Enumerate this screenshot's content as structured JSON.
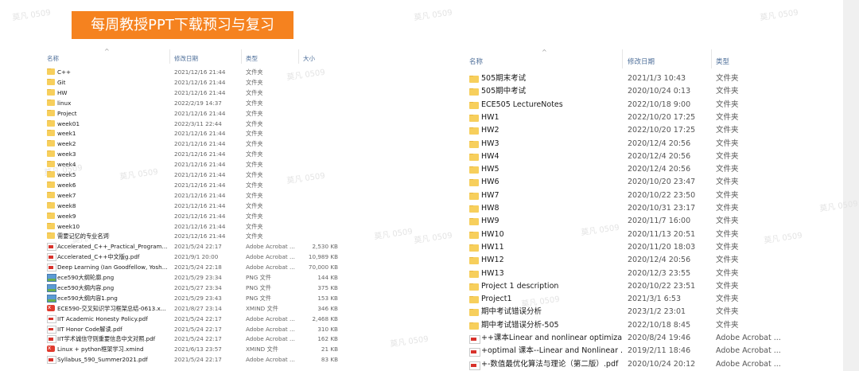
{
  "banner": {
    "title": "每周教授PPT下载预习与复习"
  },
  "watermark": "莫凡 0509",
  "left_panel": {
    "headers": {
      "name": "名称",
      "date": "修改日期",
      "type": "类型",
      "size": "大小"
    },
    "items": [
      {
        "icon": "folder-icon",
        "name": "C++",
        "date": "2021/12/16 21:44",
        "type": "文件夹",
        "size": ""
      },
      {
        "icon": "folder-icon",
        "name": "Git",
        "date": "2021/12/16 21:44",
        "type": "文件夹",
        "size": ""
      },
      {
        "icon": "folder-icon",
        "name": "HW",
        "date": "2021/12/16 21:44",
        "type": "文件夹",
        "size": ""
      },
      {
        "icon": "folder-icon",
        "name": "linux",
        "date": "2022/2/19 14:37",
        "type": "文件夹",
        "size": ""
      },
      {
        "icon": "folder-icon",
        "name": "Project",
        "date": "2021/12/16 21:44",
        "type": "文件夹",
        "size": ""
      },
      {
        "icon": "folder-icon",
        "name": "week01",
        "date": "2022/3/11 22:44",
        "type": "文件夹",
        "size": ""
      },
      {
        "icon": "folder-icon",
        "name": "week1",
        "date": "2021/12/16 21:44",
        "type": "文件夹",
        "size": ""
      },
      {
        "icon": "folder-icon",
        "name": "week2",
        "date": "2021/12/16 21:44",
        "type": "文件夹",
        "size": ""
      },
      {
        "icon": "folder-icon",
        "name": "week3",
        "date": "2021/12/16 21:44",
        "type": "文件夹",
        "size": ""
      },
      {
        "icon": "folder-icon",
        "name": "week4",
        "date": "2021/12/16 21:44",
        "type": "文件夹",
        "size": ""
      },
      {
        "icon": "folder-icon",
        "name": "week5",
        "date": "2021/12/16 21:44",
        "type": "文件夹",
        "size": ""
      },
      {
        "icon": "folder-icon",
        "name": "week6",
        "date": "2021/12/16 21:44",
        "type": "文件夹",
        "size": ""
      },
      {
        "icon": "folder-icon",
        "name": "week7",
        "date": "2021/12/16 21:44",
        "type": "文件夹",
        "size": ""
      },
      {
        "icon": "folder-icon",
        "name": "week8",
        "date": "2021/12/16 21:44",
        "type": "文件夹",
        "size": ""
      },
      {
        "icon": "folder-icon",
        "name": "week9",
        "date": "2021/12/16 21:44",
        "type": "文件夹",
        "size": ""
      },
      {
        "icon": "folder-icon",
        "name": "week10",
        "date": "2021/12/16 21:44",
        "type": "文件夹",
        "size": ""
      },
      {
        "icon": "folder-icon",
        "name": "需要记忆的专业名词",
        "date": "2021/12/16 21:44",
        "type": "文件夹",
        "size": ""
      },
      {
        "icon": "pdf-icon",
        "name": "Accelerated_C++_Practical_Program...",
        "date": "2021/5/24 22:17",
        "type": "Adobe Acrobat ...",
        "size": "2,530 KB"
      },
      {
        "icon": "pdf-icon",
        "name": "Accelerated_C++中文版g.pdf",
        "date": "2021/9/1 20:00",
        "type": "Adobe Acrobat ...",
        "size": "10,989 KB"
      },
      {
        "icon": "pdf-icon",
        "name": "Deep Learning (Ian Goodfellow, Yosh...",
        "date": "2021/5/24 22:18",
        "type": "Adobe Acrobat ...",
        "size": "70,000 KB"
      },
      {
        "icon": "png-icon",
        "name": "ece590大纲轮廓.png",
        "date": "2021/5/29 23:34",
        "type": "PNG 文件",
        "size": "144 KB"
      },
      {
        "icon": "png-icon",
        "name": "ece590大纲内容.png",
        "date": "2021/5/27 23:34",
        "type": "PNG 文件",
        "size": "375 KB"
      },
      {
        "icon": "png-icon",
        "name": "ece590大纲内容1.png",
        "date": "2021/5/29 23:43",
        "type": "PNG 文件",
        "size": "153 KB"
      },
      {
        "icon": "xmind-icon",
        "name": "ECE590-交叉知识学习框架总结-0613.x...",
        "date": "2021/8/27 23:14",
        "type": "XMIND 文件",
        "size": "346 KB"
      },
      {
        "icon": "pdf-icon",
        "name": "IIT Academic Honesty Policy.pdf",
        "date": "2021/5/24 22:17",
        "type": "Adobe Acrobat ...",
        "size": "2,468 KB"
      },
      {
        "icon": "pdf-icon",
        "name": "IIT Honor Code解读.pdf",
        "date": "2021/5/24 22:17",
        "type": "Adobe Acrobat ...",
        "size": "310 KB"
      },
      {
        "icon": "pdf-icon",
        "name": "IIT学术诚信守则重要信息中文对照.pdf",
        "date": "2021/5/24 22:17",
        "type": "Adobe Acrobat ...",
        "size": "162 KB"
      },
      {
        "icon": "xmind-icon",
        "name": "Linux + python框架学习.xmind",
        "date": "2021/6/13 23:57",
        "type": "XMIND 文件",
        "size": "21 KB"
      },
      {
        "icon": "pdf-icon",
        "name": "Syllabus_590_Summer2021.pdf",
        "date": "2021/5/24 22:17",
        "type": "Adobe Acrobat ...",
        "size": "83 KB"
      }
    ]
  },
  "right_panel": {
    "headers": {
      "name": "名称",
      "date": "修改日期",
      "type": "类型"
    },
    "items": [
      {
        "icon": "folder-icon",
        "name": "505期末考试",
        "date": "2021/1/3 10:43",
        "type": "文件夹"
      },
      {
        "icon": "folder-icon",
        "name": "505期中考试",
        "date": "2020/10/24 0:13",
        "type": "文件夹"
      },
      {
        "icon": "folder-icon",
        "name": "ECE505 LectureNotes",
        "date": "2022/10/18 9:00",
        "type": "文件夹"
      },
      {
        "icon": "folder-icon",
        "name": "HW1",
        "date": "2022/10/20 17:25",
        "type": "文件夹"
      },
      {
        "icon": "folder-icon",
        "name": "HW2",
        "date": "2022/10/20 17:25",
        "type": "文件夹"
      },
      {
        "icon": "folder-icon",
        "name": "HW3",
        "date": "2020/12/4 20:56",
        "type": "文件夹"
      },
      {
        "icon": "folder-icon",
        "name": "HW4",
        "date": "2020/12/4 20:56",
        "type": "文件夹"
      },
      {
        "icon": "folder-icon",
        "name": "HW5",
        "date": "2020/12/4 20:56",
        "type": "文件夹"
      },
      {
        "icon": "folder-icon",
        "name": "HW6",
        "date": "2020/10/20 23:47",
        "type": "文件夹"
      },
      {
        "icon": "folder-icon",
        "name": "HW7",
        "date": "2020/10/22 23:50",
        "type": "文件夹"
      },
      {
        "icon": "folder-icon",
        "name": "HW8",
        "date": "2020/10/31 23:17",
        "type": "文件夹"
      },
      {
        "icon": "folder-icon",
        "name": "HW9",
        "date": "2020/11/7 16:00",
        "type": "文件夹"
      },
      {
        "icon": "folder-icon",
        "name": "HW10",
        "date": "2020/11/13 20:51",
        "type": "文件夹"
      },
      {
        "icon": "folder-icon",
        "name": "HW11",
        "date": "2020/11/20 18:03",
        "type": "文件夹"
      },
      {
        "icon": "folder-icon",
        "name": "HW12",
        "date": "2020/12/4 20:56",
        "type": "文件夹"
      },
      {
        "icon": "folder-icon",
        "name": "HW13",
        "date": "2020/12/3 23:55",
        "type": "文件夹"
      },
      {
        "icon": "folder-icon",
        "name": "Project 1 description",
        "date": "2020/10/22 23:51",
        "type": "文件夹"
      },
      {
        "icon": "folder-icon",
        "name": "Project1",
        "date": "2021/3/1 6:53",
        "type": "文件夹"
      },
      {
        "icon": "folder-icon",
        "name": "期中考试错误分析",
        "date": "2023/1/2 23:01",
        "type": "文件夹"
      },
      {
        "icon": "folder-icon",
        "name": "期中考试错误分析-505",
        "date": "2022/10/18 8:45",
        "type": "文件夹"
      },
      {
        "icon": "pdf-icon",
        "name": "++课本Linear and nonlinear optimiza...",
        "date": "2020/8/24 19:46",
        "type": "Adobe Acrobat ..."
      },
      {
        "icon": "pdf-icon",
        "name": "+optimal 课本--Linear and Nonlinear ...",
        "date": "2019/2/11 18:46",
        "type": "Adobe Acrobat ..."
      },
      {
        "icon": "pdf-icon",
        "name": "+-数值最优化算法与理论（第二版）.pdf",
        "date": "2020/10/24 20:12",
        "type": "Adobe Acrobat ..."
      }
    ]
  }
}
